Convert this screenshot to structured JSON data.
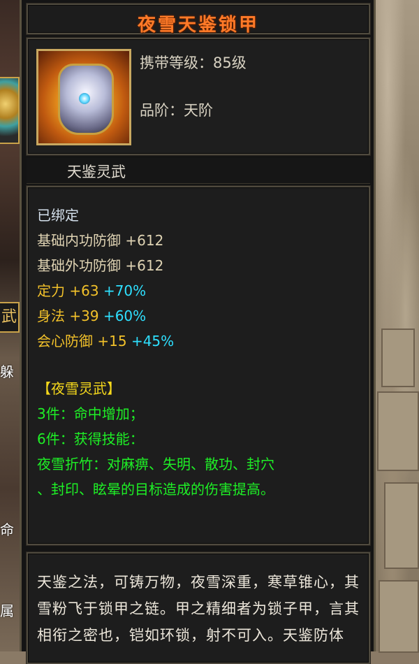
{
  "item": {
    "name": "夜雪天鉴锁甲",
    "carry_level": "携带等级：85级",
    "grade": "品阶：天阶",
    "set_label": "天鉴灵武"
  },
  "stats": {
    "bound": "已绑定",
    "base_inner_def": {
      "label": "基础内功防御",
      "value": "+612"
    },
    "base_outer_def": {
      "label": "基础外功防御",
      "value": "+612"
    },
    "focus": {
      "label": "定力",
      "value": "+63",
      "bonus": "+70%"
    },
    "agility": {
      "label": "身法",
      "value": "+39",
      "bonus": "+60%"
    },
    "crit_def": {
      "label": "会心防御",
      "value": "+15",
      "bonus": "+45%"
    }
  },
  "set": {
    "title": "【夜雪灵武】",
    "bonus3": "3件：命中增加；",
    "bonus6": "6件：获得技能：",
    "skill_line1": "夜雪折竹：对麻痹、失明、散功、封穴",
    "skill_line2": "、封印、眩晕的目标造成的伤害提高。"
  },
  "description": "天鉴之法，可铸万物，夜雪深重，寒草锥心，其雪粉飞于锁甲之链。甲之精细者为锁子甲，言其相衔之密也，铠如环锁，射不可入。天鉴防体",
  "background": {
    "left_tag": "武",
    "left_texts": [
      "躲",
      "命",
      "属"
    ]
  },
  "colors": {
    "title": "#ff7a28",
    "gold_stat": "#f2c12a",
    "cyan_bonus": "#2ee0ff",
    "set_green": "#1ef026",
    "set_title": "#f5d81c"
  }
}
